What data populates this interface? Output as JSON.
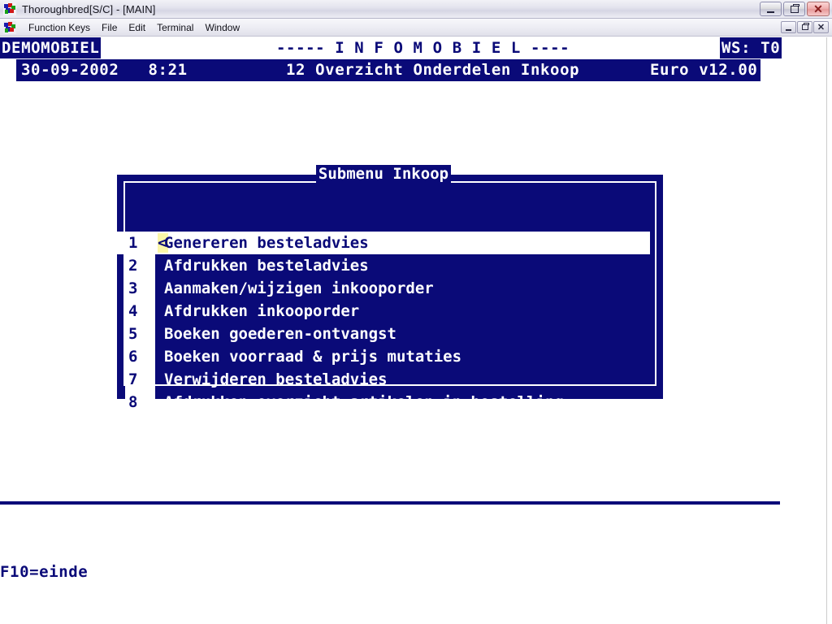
{
  "window": {
    "title": "Thoroughbred[S/C] - [MAIN]",
    "app_icon": "thoroughbred-logo-icon",
    "controls": {
      "minimize": "minimize-icon",
      "restore": "restore-icon",
      "close": "close-icon"
    }
  },
  "menubar": {
    "icon": "thoroughbred-logo-icon",
    "items": [
      {
        "label": "Function Keys"
      },
      {
        "label": "File"
      },
      {
        "label": "Edit"
      },
      {
        "label": "Terminal"
      },
      {
        "label": "Window"
      }
    ],
    "mdi_controls": {
      "minimize": "minimize-icon",
      "restore": "restore-icon",
      "close": "close-icon"
    }
  },
  "terminal": {
    "header": {
      "company": "DEMOMOBIEL",
      "app_title": "----- I N F O M O B I E L ----",
      "workstation": "WS: T0",
      "date": "30-09-2002",
      "time": "8:21",
      "screen": "12 Overzicht Onderdelen Inkoop",
      "version": "Euro v12.00"
    },
    "menubox": {
      "title": "Submenu Inkoop",
      "cursor_char": "<",
      "selected_index": 0,
      "items": [
        {
          "number": "1",
          "label": "Genereren besteladvies"
        },
        {
          "number": "2",
          "label": "Afdrukken besteladvies"
        },
        {
          "number": "3",
          "label": "Aanmaken/wijzigen inkooporder"
        },
        {
          "number": "4",
          "label": "Afdrukken inkooporder"
        },
        {
          "number": "5",
          "label": "Boeken goederen-ontvangst"
        },
        {
          "number": "6",
          "label": "Boeken voorraad & prijs mutaties"
        },
        {
          "number": "7",
          "label": "Verwijderen besteladvies"
        },
        {
          "number": "8",
          "label": "Afdrukken overzicht artikelen in bestelling"
        }
      ]
    },
    "footer": {
      "hint": "F10=einde"
    }
  },
  "colors": {
    "terminal_navy": "#0a0a78",
    "terminal_white": "#ffffff",
    "cursor_yellow": "#fbf6a8"
  }
}
